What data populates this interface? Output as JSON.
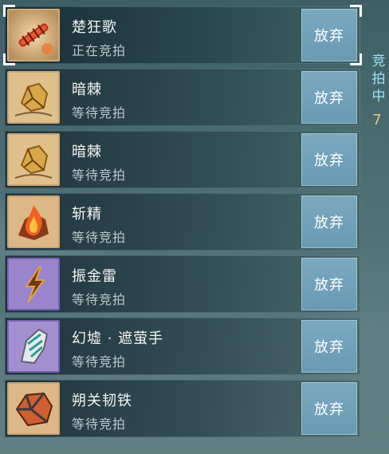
{
  "auction_list": [
    {
      "name": "楚狂歌",
      "status": "正在竞拍",
      "action": "放弃",
      "icon": "red-sword-scroll-icon",
      "frame": "#c8a070"
    },
    {
      "name": "暗棘",
      "status": "等待竞拍",
      "action": "放弃",
      "icon": "cracked-gold-stone-icon",
      "frame": "#c8a070"
    },
    {
      "name": "暗棘",
      "status": "等待竞拍",
      "action": "放弃",
      "icon": "cracked-gold-stone-icon",
      "frame": "#c8a070"
    },
    {
      "name": "斩精",
      "status": "等待竞拍",
      "action": "放弃",
      "icon": "fire-stone-icon",
      "frame": "#c8a070"
    },
    {
      "name": "振金雷",
      "status": "等待竞拍",
      "action": "放弃",
      "icon": "lightning-icon",
      "frame": "#8a6fc0"
    },
    {
      "name": "幻墟 · 遮萤手",
      "status": "等待竞拍",
      "action": "放弃",
      "icon": "jade-gauntlet-icon",
      "frame": "#8a6fc0"
    },
    {
      "name": "朔关韧铁",
      "status": "等待竞拍",
      "action": "放弃",
      "icon": "iron-ore-icon",
      "frame": "#c8a070"
    }
  ],
  "side_panel": {
    "label": "竞拍中",
    "count": "7"
  },
  "colors": {
    "accent": "#6a9ab2",
    "count": "#e8c878",
    "side_label": "#9fe0f0"
  }
}
